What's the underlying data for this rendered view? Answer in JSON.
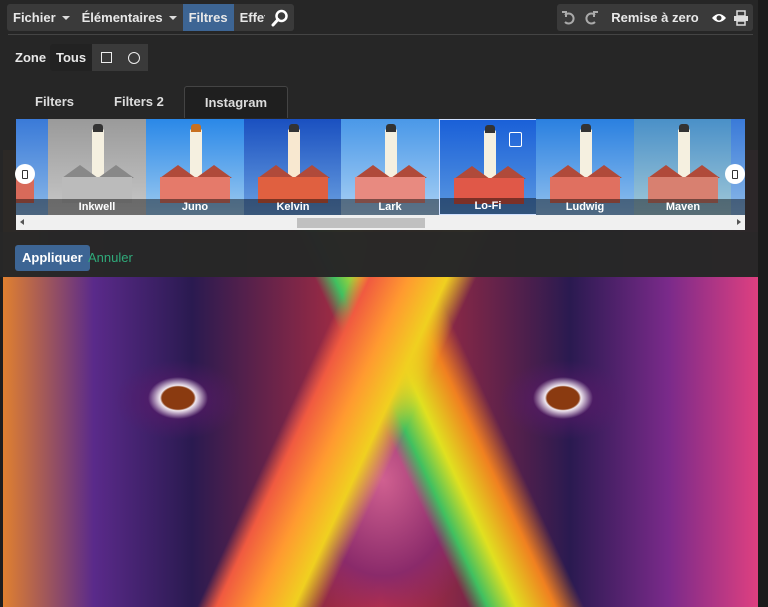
{
  "toolbar": {
    "menus": [
      {
        "label": "Fichier"
      },
      {
        "label": "Élémentaires"
      },
      {
        "label": "Filtres"
      },
      {
        "label": "Effets"
      }
    ],
    "reset_label": "Remise à zero"
  },
  "zone": {
    "label": "Zone",
    "all_label": "Tous"
  },
  "tabs": [
    {
      "label": "Filters"
    },
    {
      "label": "Filters 2"
    },
    {
      "label": "Instagram"
    }
  ],
  "filters": [
    {
      "label": "Inkwell"
    },
    {
      "label": "Juno"
    },
    {
      "label": "Kelvin"
    },
    {
      "label": "Lark"
    },
    {
      "label": "Lo-Fi"
    },
    {
      "label": "Ludwig"
    },
    {
      "label": "Maven"
    }
  ],
  "selected_filter": "Lo-Fi",
  "actions": {
    "apply": "Appliquer",
    "cancel": "Annuler"
  },
  "colors": {
    "accent": "#3d6594",
    "cancel": "#2faa7a",
    "background": "#262626"
  }
}
